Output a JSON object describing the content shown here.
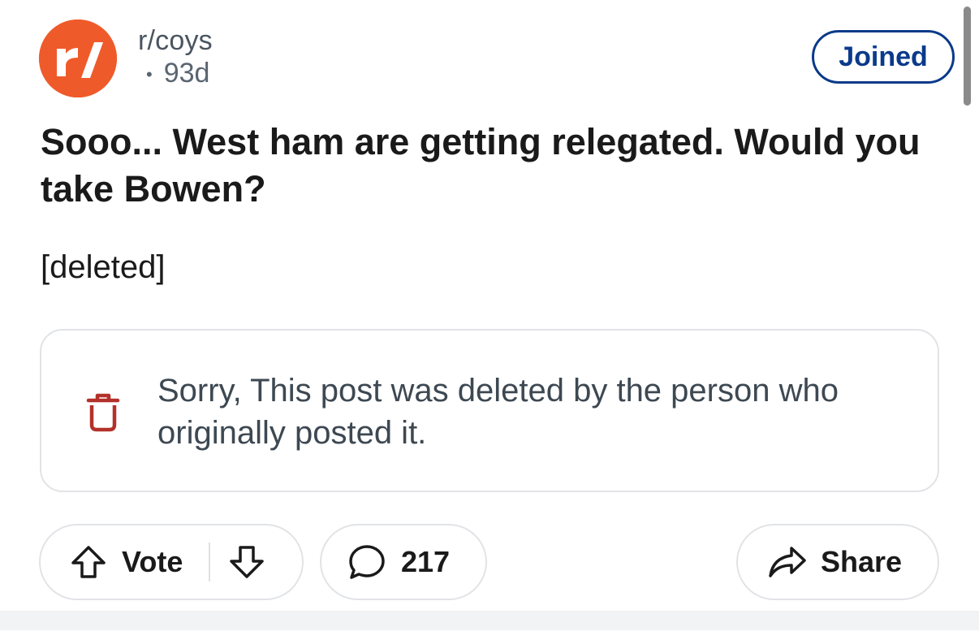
{
  "post_header": {
    "subreddit": "r/coys",
    "separator": "•",
    "age": "93d",
    "join_label": "Joined"
  },
  "post": {
    "title": "Sooo... West ham are getting relegated. Would you take Bowen?",
    "body": "[deleted]"
  },
  "notice": {
    "text": "Sorry, This post was deleted by the person who originally posted it.",
    "icon": "trash-icon"
  },
  "actions": {
    "vote_label": "Vote",
    "comment_count": "217",
    "share_label": "Share"
  },
  "colors": {
    "subreddit_avatar": "#ef5a2a",
    "join_accent": "#0a3a8a",
    "trash_icon": "#b3312a"
  }
}
